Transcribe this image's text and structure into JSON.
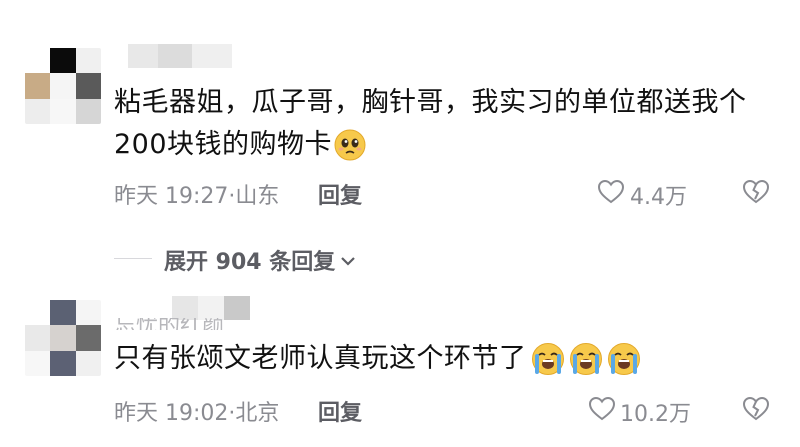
{
  "comments": [
    {
      "text_line1": "粘毛器姐，瓜子哥，胸针哥，我实习的单位都送我个",
      "text_line2": "200块钱的购物卡",
      "emoji": "pleading-face",
      "time": "昨天 19:27",
      "location": "山东",
      "reply_label": "回复",
      "likes": "4.4万"
    },
    {
      "username_partial": "忘忧的红颜",
      "text": "只有张颂文老师认真玩这个环节了",
      "emoji": "loudly-crying-face",
      "emoji_count": 3,
      "time": "昨天 19:02",
      "location": "北京",
      "reply_label": "回复",
      "likes": "10.2万"
    }
  ],
  "expand_replies": {
    "label": "展开 904 条回复"
  },
  "colors": {
    "text": "#111111",
    "meta": "#8a8b91",
    "action": "#5c5d63",
    "emoji_face": "#f7c94b",
    "tear": "#5aa8e6"
  }
}
